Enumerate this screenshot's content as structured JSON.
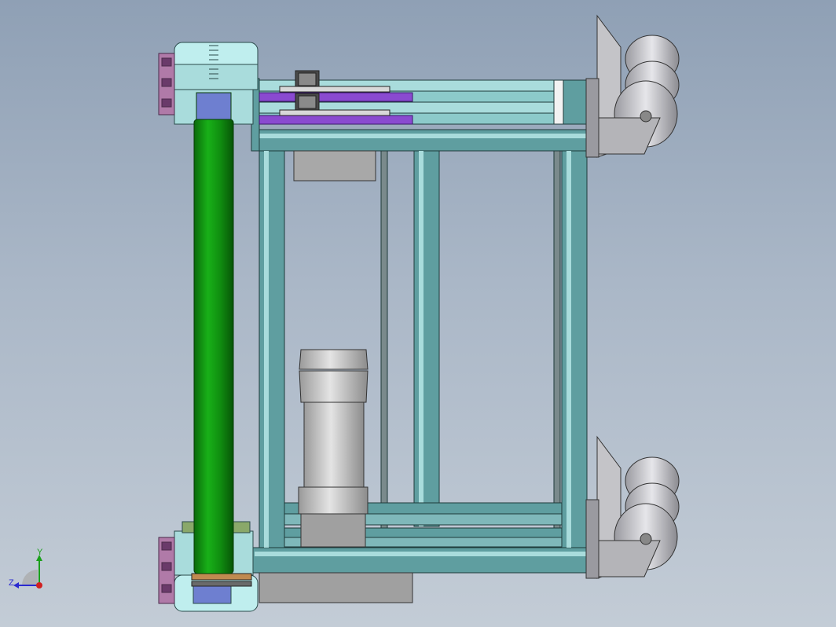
{
  "viewport": {
    "background_top": "#8fa0b5",
    "background_bottom": "#c3ccd6"
  },
  "model": {
    "colors": {
      "frame": "#5f9ea0",
      "frame_light": "#a9dcdc",
      "roller": "#109010",
      "roller_dark": "#0a6a0a",
      "motor": "#b8b8b8",
      "motor_dark": "#8c8c8c",
      "purple_strip": "#8a4ad0",
      "bracket_pink": "#b07aa8",
      "wheel": "#c0c0c4",
      "bearing_blue": "#6e7fd0"
    }
  },
  "triad": {
    "y_label": "Y",
    "z_label": "Z",
    "y_color": "#1aa01a",
    "z_color": "#2a2ad0",
    "origin_color": "#d02020"
  }
}
